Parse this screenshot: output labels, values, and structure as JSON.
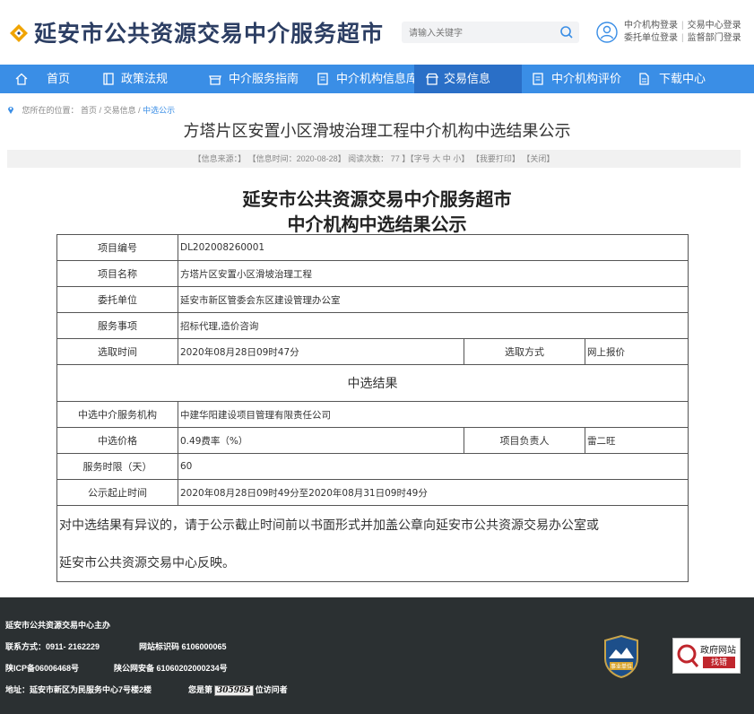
{
  "header": {
    "site_title": "延安市公共资源交易中介服务超市",
    "search_placeholder": "请输入关键字",
    "links": {
      "agency_login": "中介机构登录",
      "center_login": "交易中心登录",
      "client_login": "委托单位登录",
      "supervisor_login": "监督部门登录"
    }
  },
  "nav": {
    "items": [
      {
        "label": "首页",
        "icon": "home-icon"
      },
      {
        "label": "政策法规",
        "icon": "book-icon"
      },
      {
        "label": "中介服务指南",
        "icon": "shop-icon"
      },
      {
        "label": "中介机构信息库",
        "icon": "document-icon"
      },
      {
        "label": "交易信息",
        "icon": "store-icon"
      },
      {
        "label": "中介机构评价",
        "icon": "document-icon"
      },
      {
        "label": "下载中心",
        "icon": "download-icon"
      }
    ]
  },
  "breadcrumb": {
    "prefix": "您所在的位置：",
    "home": "首页",
    "sep1": " / ",
    "trade": "交易信息",
    "sep2": " / ",
    "current": "中选公示"
  },
  "page": {
    "title": "方塔片区安置小区滑坡治理工程中介机构中选结果公示",
    "info": {
      "source": "【信息来源：】",
      "time": "【信息时间：2020-08-28】",
      "views": "阅读次数：",
      "views_count": "77",
      "font_prefix": "】【字号",
      "font_large": "大",
      "font_medium": "中",
      "font_small": "小",
      "font_suffix": "】",
      "print": "【我要打印】",
      "close": "【关闭】"
    }
  },
  "doc": {
    "heading1": "延安市公共资源交易中介服务超市",
    "heading2": "中介机构中选结果公示",
    "project_no_label": "项目编号",
    "project_no": "DL202008260001",
    "project_name_label": "项目名称",
    "project_name": "方塔片区安置小区滑坡治理工程",
    "client_label": "委托单位",
    "client": "延安市新区管委会东区建设管理办公室",
    "service_label": "服务事项",
    "service": "招标代理,造价咨询",
    "select_time_label": "选取时间",
    "select_time": "2020年08月28日09时47分",
    "select_method_label": "选取方式",
    "select_method": "网上报价",
    "section_result": "中选结果",
    "agency_label": "中选中介服务机构",
    "agency": "中建华阳建设项目管理有限责任公司",
    "price_label": "中选价格",
    "price": "0.49费率（%）",
    "manager_label": "项目负责人",
    "manager": "雷二旺",
    "period_label": "服务时限（天）",
    "period": "60",
    "notice_label": "公示起止时间",
    "notice": "2020年08月28日09时49分至2020年08月31日09时49分",
    "objection_line1": "对中选结果有异议的，请于公示截止时间前以书面形式并加盖公章向延安市公共资源交易办公室或",
    "objection_line2": "延安市公共资源交易中心反映。"
  },
  "footer": {
    "sponsor": "延安市公共资源交易中心主办",
    "contact": "联系方式：0911- 2162229",
    "site_code": "网站标识码 6106000065",
    "icp": "陕ICP备06006468号",
    "security": "陕公网安备 61060202000234号",
    "address": "地址：延安市新区为民服务中心7号楼2楼",
    "visitor_prefix": "您是第",
    "visitor_count": "305985",
    "visitor_suffix": "位访问者",
    "badge1_text": "事业单位",
    "badge2_text": "政府网站",
    "badge2_sub": "找错"
  },
  "colors": {
    "nav_bg": "#3a8ee6",
    "nav_active": "#2a6fc7",
    "title_color": "#2c3e63",
    "footer_bg": "#2b3032"
  }
}
